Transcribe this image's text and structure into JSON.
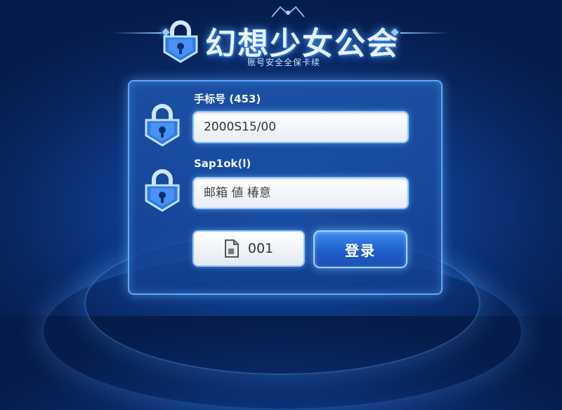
{
  "header": {
    "title": "幻想少女公会",
    "subtitle": "账号安全全保卡续"
  },
  "form": {
    "field1": {
      "label": "手标号 (453)",
      "value": "2000S15/00"
    },
    "field2": {
      "label": "Sap1ok(l)",
      "placeholder": "邮箱 値 椿意"
    },
    "captcha": {
      "code": "001",
      "icon": "document-icon"
    },
    "submit_label": "登录"
  },
  "colors": {
    "background": "#0d3a86",
    "panel_border": "#5fa8ff",
    "button": "#1e5fcc"
  }
}
